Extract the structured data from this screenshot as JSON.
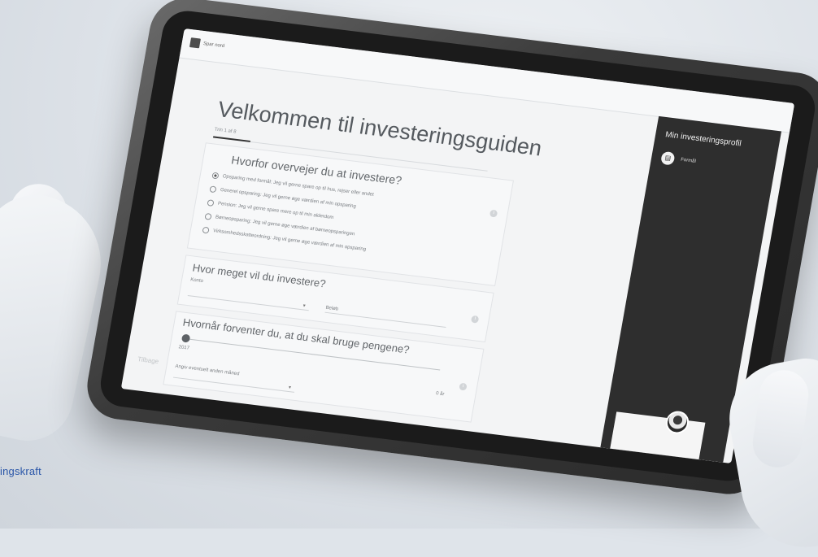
{
  "side_text": "ingskraft",
  "app": {
    "logo_text": "Spar nord"
  },
  "guide": {
    "title": "Velkommen til investeringsguiden",
    "step_label": "Trin 1 af 8",
    "question1": {
      "title": "Hvorfor overvejer du at investere?",
      "options": [
        "Opsparing med formål: Jeg vil gerne spare op til hus, rejser eller andet",
        "Generel opsparing: Jeg vil gerne øge værdien af min opsparing",
        "Pension: Jeg vil gerne spare mere op til min alderdom",
        "Børneopsparing: Jeg vil gerne øge værdien af børneopsparingen",
        "Virksomhedsskatteordning: Jeg vil gerne øge værdien af min opsparing"
      ],
      "selected_index": 0
    },
    "question2": {
      "title": "Hvor meget vil du investere?",
      "account_label": "Konto",
      "amount_label": "Beløb"
    },
    "question3": {
      "title": "Hvornår forventer du, at du skal bruge pengene?",
      "slider_start": "2017",
      "slider_value": "0 år",
      "month_label": "Angiv eventuelt anden måned"
    },
    "back_button": "Tilbage"
  },
  "panel": {
    "title": "Min investeringsprofil",
    "item_label": "Formål"
  }
}
